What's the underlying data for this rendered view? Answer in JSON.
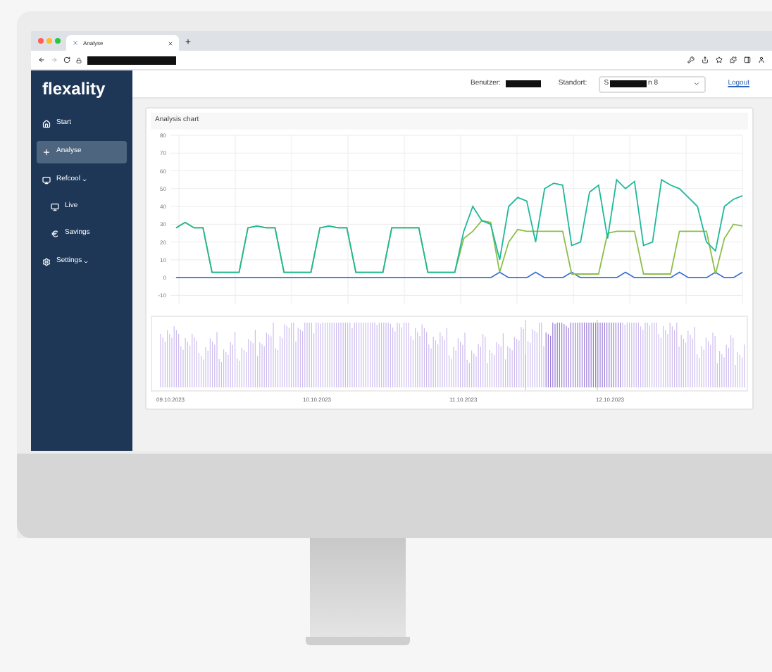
{
  "browser": {
    "tab": {
      "title": "Analyse"
    }
  },
  "sidebar": {
    "logo": "flexality",
    "items": [
      {
        "label": "Start",
        "kind": "home",
        "selected": false
      },
      {
        "label": "Analyse",
        "kind": "plus",
        "selected": true
      },
      {
        "label": "Refcool",
        "kind": "monitor",
        "selected": false,
        "dropdown": true,
        "children": [
          {
            "label": "Live",
            "kind": "monitor",
            "selected": false
          },
          {
            "label": "Savings",
            "kind": "euro",
            "selected": false
          }
        ]
      },
      {
        "label": "Settings",
        "kind": "gear",
        "selected": false,
        "dropdown": true
      }
    ]
  },
  "header": {
    "user_label": "Benutzer:",
    "location_label": "Standort:",
    "location_value_start": "S",
    "location_value_end": "n 8",
    "logout": "Logout"
  },
  "chart_card": {
    "title": "Analysis chart",
    "chart_data": {
      "type": "line",
      "grid": true,
      "ylim": [
        -15,
        80
      ],
      "yticks": [
        -10,
        0,
        10,
        20,
        30,
        40,
        50,
        60,
        70,
        80
      ],
      "series": [
        {
          "color": "#1fb89a",
          "values": [
            28,
            31,
            28,
            28,
            3,
            3,
            3,
            3,
            28,
            29,
            28,
            28,
            3,
            3,
            3,
            3,
            28,
            29,
            28,
            28,
            3,
            3,
            3,
            3,
            28,
            28,
            28,
            28,
            3,
            3,
            3,
            3,
            26,
            40,
            32,
            30,
            10,
            40,
            45,
            43,
            20,
            50,
            53,
            52,
            18,
            20,
            48,
            52,
            22,
            55,
            50,
            54,
            18,
            20,
            55,
            52,
            50,
            45,
            40,
            20,
            15,
            40,
            44,
            46
          ]
        },
        {
          "color": "#8cbf4a",
          "values": [
            28,
            31,
            28,
            28,
            3,
            3,
            3,
            3,
            28,
            29,
            28,
            28,
            3,
            3,
            3,
            3,
            28,
            29,
            28,
            28,
            3,
            3,
            3,
            3,
            28,
            28,
            28,
            28,
            3,
            3,
            3,
            3,
            22,
            26,
            32,
            31,
            3,
            20,
            27,
            26,
            26,
            26,
            26,
            26,
            2,
            2,
            2,
            2,
            25,
            26,
            26,
            26,
            2,
            2,
            2,
            2,
            26,
            26,
            26,
            26,
            2,
            22,
            30,
            29
          ]
        },
        {
          "color": "#3b6fd4",
          "values": [
            0,
            0,
            0,
            0,
            0,
            0,
            0,
            0,
            0,
            0,
            0,
            0,
            0,
            0,
            0,
            0,
            0,
            0,
            0,
            0,
            0,
            0,
            0,
            0,
            0,
            0,
            0,
            0,
            0,
            0,
            0,
            0,
            0,
            0,
            0,
            0,
            3,
            0,
            0,
            0,
            3,
            0,
            0,
            0,
            3,
            0,
            0,
            0,
            0,
            0,
            3,
            0,
            0,
            0,
            0,
            0,
            3,
            0,
            0,
            0,
            3,
            0,
            0,
            3
          ]
        }
      ]
    },
    "navigator": {
      "dates": [
        "09.10.2023",
        "10.10.2023",
        "11.10.2023",
        "12.10.2023"
      ]
    }
  }
}
